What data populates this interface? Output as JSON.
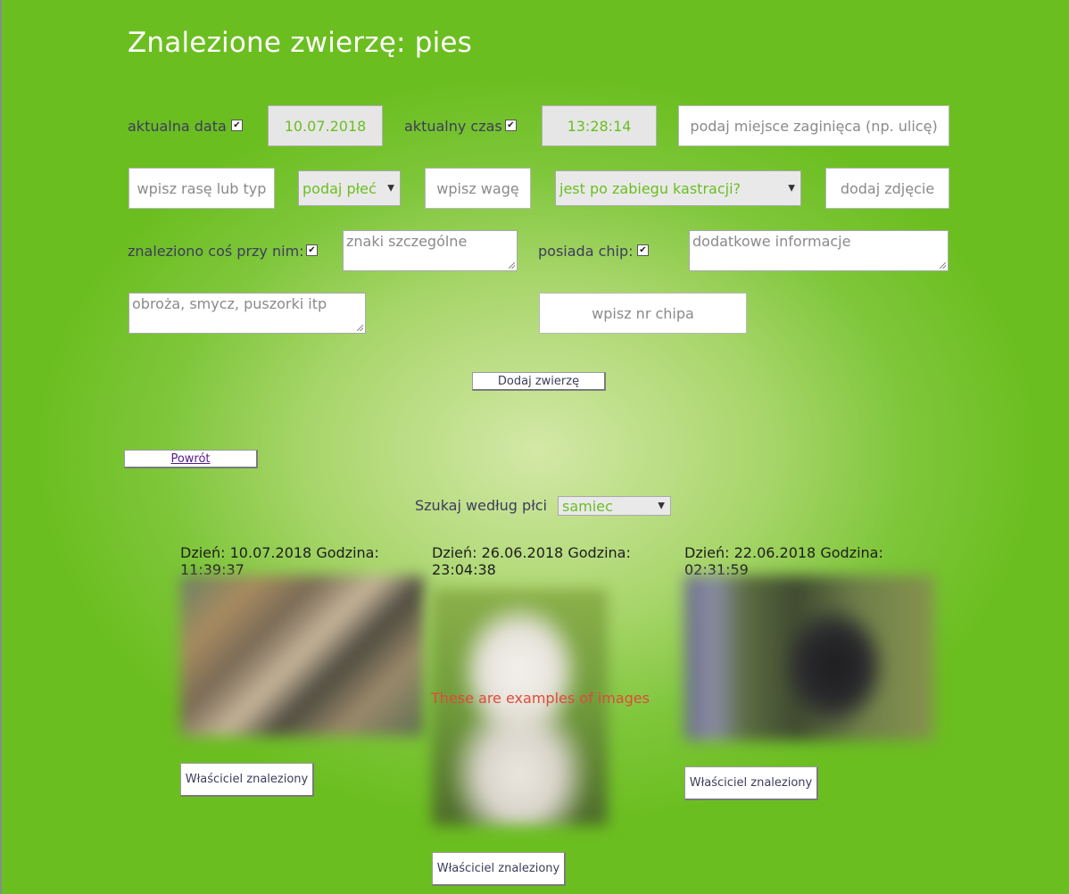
{
  "page": {
    "title": "Znalezione zwierzę: pies"
  },
  "form": {
    "date_label": "aktualna data",
    "date_value": "10.07.2018",
    "time_label": "aktualny czas",
    "time_value": "13:28:14",
    "place_placeholder": "podaj miejsce zaginięca (np. ulicę)",
    "breed_placeholder": "wpisz rasę lub typ",
    "sex_select": "podaj płeć",
    "weight_placeholder": "wpisz wagę",
    "castration_select": "jest po zabiegu kastracji?",
    "photo_placeholder": "dodaj zdjęcie",
    "found_label": "znaleziono coś przy nim:",
    "marks_placeholder": "znaki szczególne",
    "chip_label": "posiada chip:",
    "extra_placeholder": "dodatkowe informacje",
    "items_placeholder": "obroża, smycz, puszorki itp",
    "chip_placeholder": "wpisz nr chipa",
    "submit_label": "Dodaj zwierzę"
  },
  "nav": {
    "back_label": "Powrót"
  },
  "filter": {
    "label": "Szukaj według płci",
    "value": "samiec"
  },
  "results": [
    {
      "date": "Dzień: 10.07.2018 Godzina: 11:39:37",
      "button": "Właściciel znaleziony"
    },
    {
      "date": "Dzień: 26.06.2018 Godzina: 23:04:38",
      "button": "Właściciel znaleziony"
    },
    {
      "date": "Dzień: 22.06.2018 Godzina: 02:31:59",
      "button": "Właściciel znaleziony"
    }
  ],
  "overlay_note": "These are examples of images",
  "colors": {
    "accent": "#6bbe20",
    "text": "#3d3c5c",
    "note": "#e04a3a"
  },
  "icons": {
    "checkbox": "checkbox-checked-icon",
    "dropdown": "chevron-down-icon"
  }
}
